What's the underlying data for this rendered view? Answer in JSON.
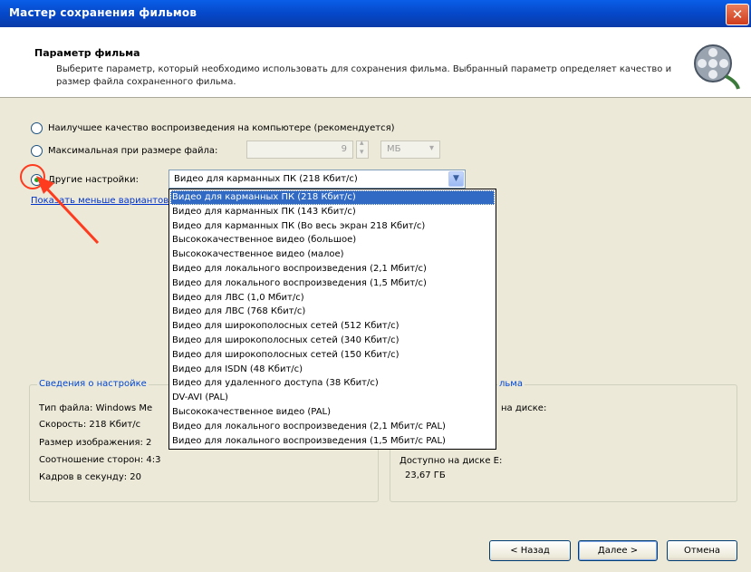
{
  "window": {
    "title": "Мастер сохранения фильмов",
    "close_glyph": "✕"
  },
  "header": {
    "title": "Параметр фильма",
    "description": "Выберите параметр, который необходимо использовать для сохранения фильма. Выбранный параметр определяет качество и размер файла сохраненного фильма.",
    "icon": "film-reel-icon"
  },
  "options": {
    "best_quality_label": "Наилучшее качество воспроизведения на компьютере (рекомендуется)",
    "max_size_label": "Максимальная при размере файла:",
    "max_size_value": "9",
    "max_size_unit": "МБ",
    "other_label": "Другие настройки:",
    "other_selected": "Видео для карманных ПК (218 Кбит/с)",
    "show_fewer_link": "Показать меньше вариантов..."
  },
  "dropdown_items": [
    "Видео для карманных ПК (218 Кбит/с)",
    "Видео для карманных ПК (143 Кбит/с)",
    "Видео для карманных ПК (Во весь экран 218 Кбит/с)",
    "Высококачественное видео (большое)",
    "Высококачественное видео (малое)",
    "Видео для локального воспроизведения (2,1 Мбит/с)",
    "Видео для локального воспроизведения (1,5 Мбит/с)",
    "Видео для ЛВС (1,0 Мбит/с)",
    "Видео для ЛВС (768 Кбит/с)",
    "Видео для широкополосных сетей (512 Кбит/с)",
    "Видео для широкополосных сетей (340 Кбит/с)",
    "Видео для широкополосных сетей (150 Кбит/с)",
    "Видео для ISDN (48 Кбит/с)",
    "Видео для удаленного доступа (38 Кбит/с)",
    "DV-AVI (PAL)",
    "Высококачественное видео (PAL)",
    "Видео для локального воспроизведения (2,1 Мбит/с PAL)",
    "Видео для локального воспроизведения (1,5 Мбит/с PAL)"
  ],
  "settings_group": {
    "legend": "Сведения о настройке",
    "file_type": "Тип файла: Windows Me",
    "speed": "Скорость: 218 Кбит/с",
    "image_size": "Размер изображения: 2",
    "aspect": "Соотношение сторон: 4:3",
    "fps": "Кадров в секунду: 20"
  },
  "file_group": {
    "legend": "льма",
    "on_disk": "на диске:",
    "available_label": "Доступно на диске E:",
    "available_value": "23,67 ГБ"
  },
  "buttons": {
    "back": "< Назад",
    "next": "Далее >",
    "cancel": "Отмена"
  },
  "colors": {
    "titlebar": "#0a5ee8",
    "selection": "#316ac5",
    "annotation": "#ff3b1f"
  }
}
